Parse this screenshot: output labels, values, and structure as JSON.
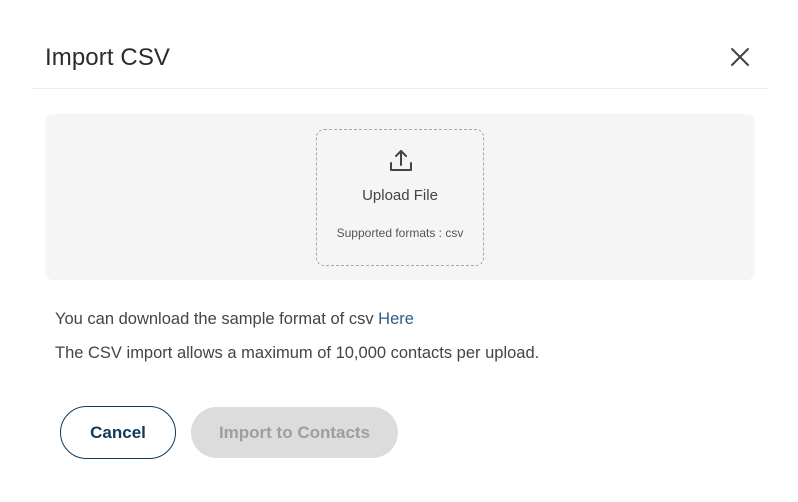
{
  "dialog": {
    "title": "Import CSV"
  },
  "upload": {
    "label": "Upload File",
    "formats": "Supported formats : csv"
  },
  "info": {
    "sample_text": "You can download the sample format of csv ",
    "sample_link": "Here",
    "limit_text": "The CSV import allows a maximum of 10,000 contacts per upload."
  },
  "actions": {
    "cancel_label": "Cancel",
    "import_label": "Import to Contacts"
  },
  "icons": {
    "close": "close-icon",
    "upload": "upload-icon"
  },
  "colors": {
    "primary": "#0e3a5c",
    "link": "#2a5f8c",
    "disabled_bg": "#dcdcdc",
    "disabled_text": "#9e9e9e"
  }
}
